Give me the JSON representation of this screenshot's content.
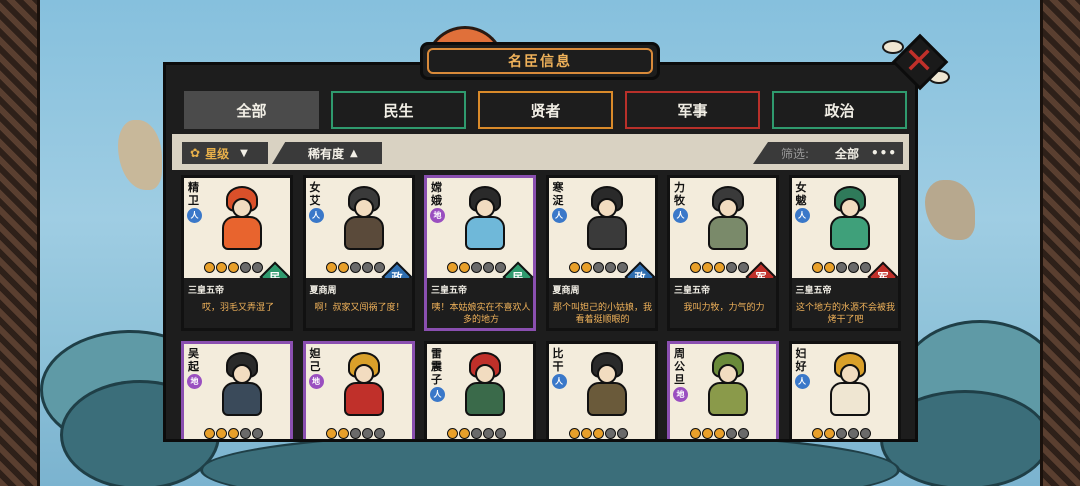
{
  "title": "名臣信息",
  "tabs": [
    {
      "label": "全部",
      "active": true
    },
    {
      "label": "民生",
      "color": "#2f9a6e"
    },
    {
      "label": "贤者",
      "color": "#d98a2a"
    },
    {
      "label": "军事",
      "color": "#b8302a"
    },
    {
      "label": "政治",
      "color": "#2f9a6e"
    }
  ],
  "filters": {
    "star_sort": "星级",
    "rarity_sort": "稀有度",
    "screen_label": "筛选:",
    "screen_value": "全部",
    "more": "•••"
  },
  "cards": [
    {
      "name": "精卫",
      "rank": "人",
      "era": "三皇五帝",
      "type": "民",
      "stars": 3,
      "quote": "哎，羽毛又弄湿了"
    },
    {
      "name": "女艾",
      "rank": "人",
      "era": "夏商周",
      "type": "政",
      "stars": 2,
      "quote": "啊！叔家又闯祸了度！"
    },
    {
      "name": "嫦娥",
      "rank": "地",
      "era": "三皇五帝",
      "type": "民",
      "stars": 2,
      "quote": "咦！本姑娘实在不喜欢人多的地方"
    },
    {
      "name": "寒浞",
      "rank": "人",
      "era": "夏商周",
      "type": "政",
      "stars": 2,
      "quote": "那个叫妲己的小姑娘，我看着挺顺眼的"
    },
    {
      "name": "力牧",
      "rank": "人",
      "era": "三皇五帝",
      "type": "军",
      "stars": 3,
      "quote": "我叫力牧，力气的力"
    },
    {
      "name": "女魃",
      "rank": "人",
      "era": "三皇五帝",
      "type": "军",
      "stars": 2,
      "quote": "这个地方的水源不会被我烤干了吧"
    },
    {
      "name": "吴起",
      "rank": "地",
      "stars": 3
    },
    {
      "name": "妲己",
      "rank": "地",
      "stars": 2
    },
    {
      "name": "雷震子",
      "rank": "人",
      "stars": 2
    },
    {
      "name": "比干",
      "rank": "人",
      "stars": 3
    },
    {
      "name": "周公旦",
      "rank": "地",
      "stars": 3
    },
    {
      "name": "妇好",
      "rank": "人",
      "stars": 2
    }
  ],
  "colors": {
    "accent": "#f0b25a",
    "panel": "#1d1d1d",
    "card": "#f3ecdc",
    "rare_border": "#8a4fb0"
  }
}
